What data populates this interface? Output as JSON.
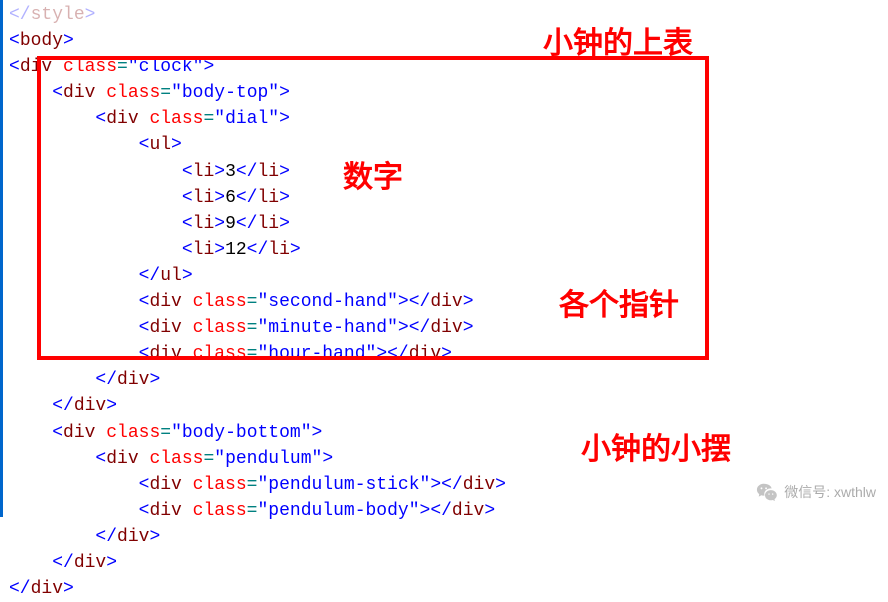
{
  "code": {
    "line_top": "</style>",
    "line1": {
      "tag": "body"
    },
    "line2": {
      "tag": "div",
      "attr": "class",
      "val": "\"clock\""
    },
    "line3": {
      "tag": "div",
      "attr": "class",
      "val": "\"body-top\""
    },
    "line4": {
      "tag": "div",
      "attr": "class",
      "val": "\"dial\""
    },
    "line5": {
      "tag": "ul"
    },
    "line6": {
      "tag": "li",
      "text": "3"
    },
    "line7": {
      "tag": "li",
      "text": "6"
    },
    "line8": {
      "tag": "li",
      "text": "9"
    },
    "line9": {
      "tag": "li",
      "text": "12"
    },
    "line10": {
      "close": "ul"
    },
    "line11": {
      "tag": "div",
      "attr": "class",
      "val": "\"second-hand\"",
      "selfclose": "div"
    },
    "line12": {
      "tag": "div",
      "attr": "class",
      "val": "\"minute-hand\"",
      "selfclose": "div"
    },
    "line13": {
      "tag": "div",
      "attr": "class",
      "val": "\"hour-hand\"",
      "selfclose": "div"
    },
    "line14": {
      "close": "div"
    },
    "line15": {
      "close": "div"
    },
    "line16": {
      "tag": "div",
      "attr": "class",
      "val": "\"body-bottom\""
    },
    "line17": {
      "tag": "div",
      "attr": "class",
      "val": "\"pendulum\""
    },
    "line18": {
      "tag": "div",
      "attr": "class",
      "val": "\"pendulum-stick\"",
      "selfclose": "div"
    },
    "line19": {
      "tag": "div",
      "attr": "class",
      "val": "\"pendulum-body\"",
      "selfclose": "div"
    },
    "line20": {
      "close": "div"
    },
    "line21": {
      "close": "div"
    },
    "line22": {
      "close": "div"
    }
  },
  "annotations": {
    "top_label": "小钟的上表",
    "digits_label": "数字",
    "hands_label": "各个指针",
    "pendulum_label": "小钟的小摆"
  },
  "watermark": {
    "label": "微信号: xwthlw"
  }
}
